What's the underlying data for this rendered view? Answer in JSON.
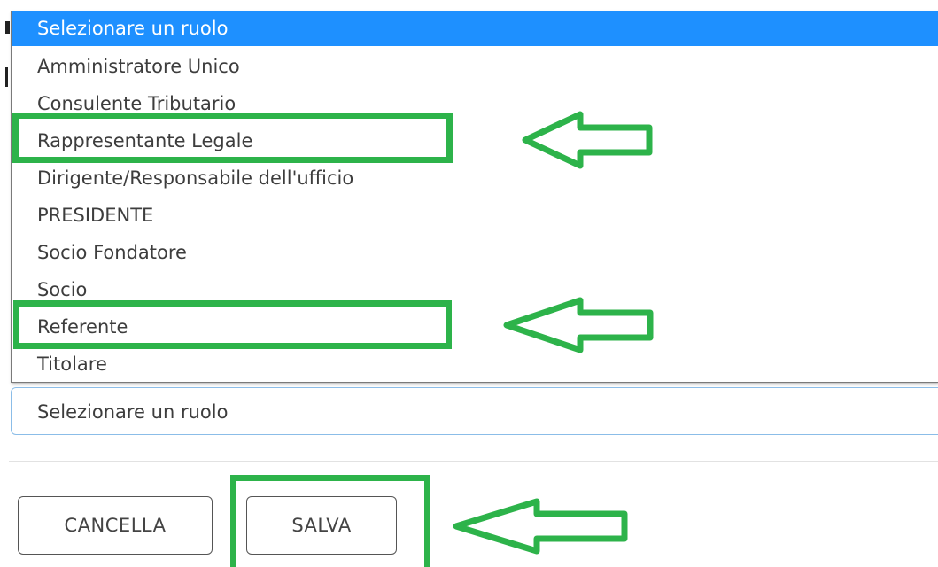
{
  "dropdown": {
    "options": [
      {
        "label": "Selezionare un ruolo",
        "selected": true
      },
      {
        "label": "Amministratore Unico",
        "selected": false
      },
      {
        "label": "Consulente Tributario",
        "selected": false
      },
      {
        "label": "Rappresentante Legale",
        "selected": false
      },
      {
        "label": "Dirigente/Responsabile dell'ufficio",
        "selected": false
      },
      {
        "label": "PRESIDENTE",
        "selected": false
      },
      {
        "label": "Socio Fondatore",
        "selected": false
      },
      {
        "label": "Socio",
        "selected": false
      },
      {
        "label": "Referente",
        "selected": false
      },
      {
        "label": "Titolare",
        "selected": false
      }
    ],
    "highlight_color": "#1e90ff"
  },
  "select": {
    "value": "Selezionare un ruolo"
  },
  "buttons": {
    "cancel_label": "CANCELLA",
    "save_label": "SALVA"
  },
  "annotations": {
    "color": "#2db34a",
    "icon": "left-arrow-icon"
  }
}
